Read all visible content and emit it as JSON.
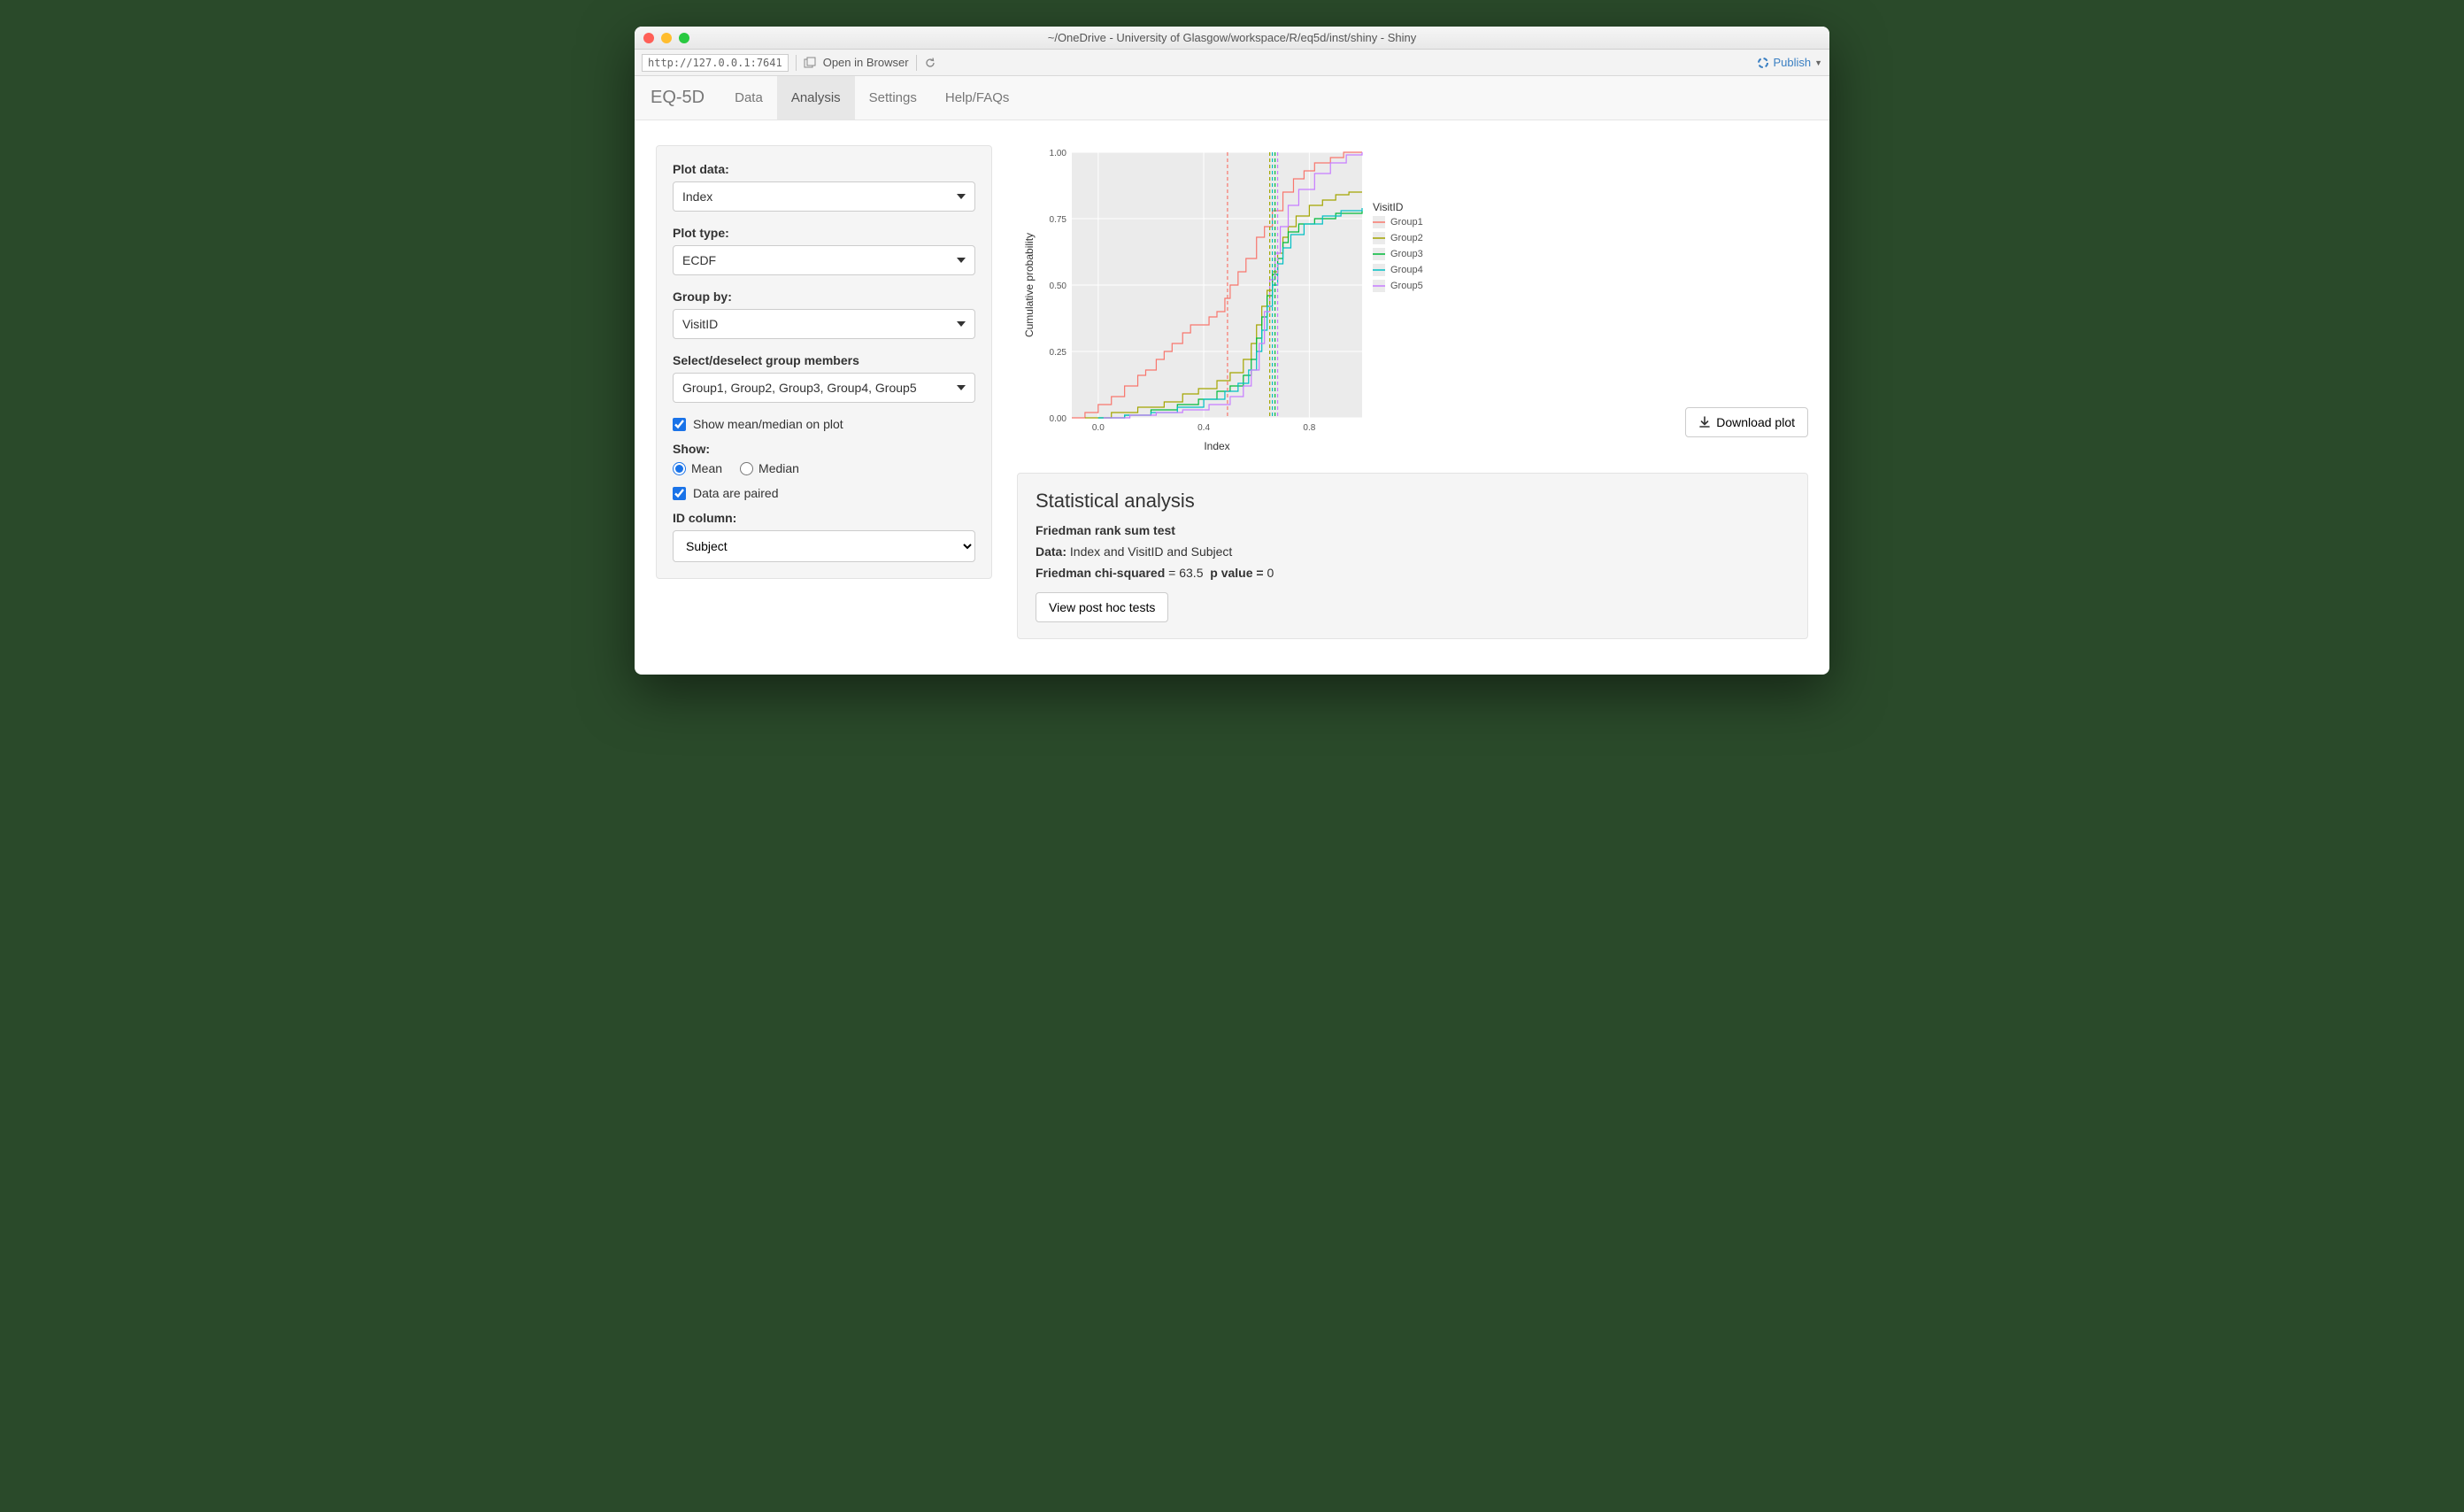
{
  "window": {
    "title": "~/OneDrive - University of Glasgow/workspace/R/eq5d/inst/shiny - Shiny"
  },
  "toolbar": {
    "url": "http://127.0.0.1:7641",
    "open_browser": "Open in Browser",
    "publish": "Publish"
  },
  "nav": {
    "brand": "EQ-5D",
    "tabs": [
      "Data",
      "Analysis",
      "Settings",
      "Help/FAQs"
    ],
    "active": "Analysis"
  },
  "sidebar": {
    "plot_data": {
      "label": "Plot data:",
      "value": "Index"
    },
    "plot_type": {
      "label": "Plot type:",
      "value": "ECDF"
    },
    "group_by": {
      "label": "Group by:",
      "value": "VisitID"
    },
    "members": {
      "label": "Select/deselect group members",
      "value": "Group1, Group2, Group3, Group4, Group5"
    },
    "show_mean_median_chk": {
      "label": "Show mean/median on plot",
      "checked": true
    },
    "show_label": "Show:",
    "radio": {
      "mean": "Mean",
      "median": "Median",
      "selected": "Mean"
    },
    "paired": {
      "label": "Data are paired",
      "checked": true
    },
    "id_col": {
      "label": "ID column:",
      "value": "Subject"
    }
  },
  "plot": {
    "download_label": "Download plot",
    "xlabel": "Index",
    "ylabel": "Cumulative probability",
    "legend_title": "VisitID",
    "legend": [
      "Group1",
      "Group2",
      "Group3",
      "Group4",
      "Group5"
    ]
  },
  "stats": {
    "heading": "Statistical analysis",
    "test_name": "Friedman rank sum test",
    "data_label": "Data:",
    "data_value": "Index and VisitID and Subject",
    "chi_label": "Friedman chi-squared",
    "chi_value": "63.5",
    "p_label": "p value =",
    "p_value": "0",
    "posthoc_btn": "View post hoc tests"
  },
  "chart_data": {
    "type": "line",
    "title": "",
    "xlabel": "Index",
    "ylabel": "Cumulative probability",
    "xlim": [
      -0.1,
      1.0
    ],
    "ylim": [
      0,
      1
    ],
    "x_ticks": [
      0.0,
      0.4,
      0.8
    ],
    "y_ticks": [
      0.0,
      0.25,
      0.5,
      0.75,
      1.0
    ],
    "legend_title": "VisitID",
    "colors": {
      "Group1": "#F8766D",
      "Group2": "#A3A500",
      "Group3": "#00BA38",
      "Group4": "#00BFC4",
      "Group5": "#C77CFF"
    },
    "means": {
      "Group1": 0.49,
      "Group2": 0.65,
      "Group3": 0.67,
      "Group4": 0.66,
      "Group5": 0.68
    },
    "series": [
      {
        "name": "Group1",
        "points": [
          [
            -0.1,
            0.0
          ],
          [
            -0.05,
            0.02
          ],
          [
            0.0,
            0.05
          ],
          [
            0.05,
            0.08
          ],
          [
            0.1,
            0.12
          ],
          [
            0.15,
            0.16
          ],
          [
            0.18,
            0.18
          ],
          [
            0.22,
            0.22
          ],
          [
            0.25,
            0.25
          ],
          [
            0.28,
            0.28
          ],
          [
            0.32,
            0.32
          ],
          [
            0.35,
            0.35
          ],
          [
            0.38,
            0.35
          ],
          [
            0.42,
            0.38
          ],
          [
            0.45,
            0.4
          ],
          [
            0.48,
            0.45
          ],
          [
            0.5,
            0.5
          ],
          [
            0.53,
            0.55
          ],
          [
            0.56,
            0.6
          ],
          [
            0.6,
            0.68
          ],
          [
            0.63,
            0.72
          ],
          [
            0.66,
            0.78
          ],
          [
            0.7,
            0.85
          ],
          [
            0.74,
            0.9
          ],
          [
            0.78,
            0.93
          ],
          [
            0.82,
            0.96
          ],
          [
            0.88,
            0.98
          ],
          [
            0.93,
            1.0
          ],
          [
            1.0,
            1.0
          ]
        ]
      },
      {
        "name": "Group2",
        "points": [
          [
            -0.05,
            0.0
          ],
          [
            0.05,
            0.02
          ],
          [
            0.15,
            0.04
          ],
          [
            0.25,
            0.06
          ],
          [
            0.32,
            0.09
          ],
          [
            0.38,
            0.11
          ],
          [
            0.45,
            0.14
          ],
          [
            0.5,
            0.17
          ],
          [
            0.55,
            0.22
          ],
          [
            0.58,
            0.28
          ],
          [
            0.6,
            0.35
          ],
          [
            0.62,
            0.42
          ],
          [
            0.64,
            0.48
          ],
          [
            0.66,
            0.55
          ],
          [
            0.68,
            0.62
          ],
          [
            0.7,
            0.68
          ],
          [
            0.72,
            0.72
          ],
          [
            0.75,
            0.76
          ],
          [
            0.8,
            0.8
          ],
          [
            0.85,
            0.82
          ],
          [
            0.9,
            0.84
          ],
          [
            0.95,
            0.85
          ],
          [
            1.0,
            0.85
          ]
        ]
      },
      {
        "name": "Group3",
        "points": [
          [
            0.0,
            0.0
          ],
          [
            0.1,
            0.01
          ],
          [
            0.2,
            0.03
          ],
          [
            0.3,
            0.05
          ],
          [
            0.38,
            0.07
          ],
          [
            0.45,
            0.1
          ],
          [
            0.5,
            0.12
          ],
          [
            0.55,
            0.16
          ],
          [
            0.58,
            0.22
          ],
          [
            0.6,
            0.3
          ],
          [
            0.62,
            0.38
          ],
          [
            0.64,
            0.46
          ],
          [
            0.66,
            0.54
          ],
          [
            0.68,
            0.6
          ],
          [
            0.7,
            0.66
          ],
          [
            0.72,
            0.7
          ],
          [
            0.76,
            0.73
          ],
          [
            0.82,
            0.75
          ],
          [
            0.9,
            0.77
          ],
          [
            1.0,
            0.78
          ]
        ]
      },
      {
        "name": "Group4",
        "points": [
          [
            0.0,
            0.0
          ],
          [
            0.1,
            0.01
          ],
          [
            0.2,
            0.02
          ],
          [
            0.3,
            0.04
          ],
          [
            0.4,
            0.07
          ],
          [
            0.48,
            0.1
          ],
          [
            0.53,
            0.13
          ],
          [
            0.57,
            0.18
          ],
          [
            0.6,
            0.25
          ],
          [
            0.62,
            0.33
          ],
          [
            0.64,
            0.42
          ],
          [
            0.66,
            0.5
          ],
          [
            0.68,
            0.58
          ],
          [
            0.7,
            0.64
          ],
          [
            0.73,
            0.69
          ],
          [
            0.78,
            0.73
          ],
          [
            0.85,
            0.76
          ],
          [
            0.92,
            0.78
          ],
          [
            1.0,
            0.79
          ]
        ]
      },
      {
        "name": "Group5",
        "points": [
          [
            0.02,
            0.0
          ],
          [
            0.12,
            0.01
          ],
          [
            0.22,
            0.02
          ],
          [
            0.32,
            0.03
          ],
          [
            0.42,
            0.05
          ],
          [
            0.5,
            0.08
          ],
          [
            0.55,
            0.12
          ],
          [
            0.58,
            0.18
          ],
          [
            0.61,
            0.28
          ],
          [
            0.63,
            0.4
          ],
          [
            0.65,
            0.52
          ],
          [
            0.67,
            0.62
          ],
          [
            0.69,
            0.72
          ],
          [
            0.72,
            0.8
          ],
          [
            0.76,
            0.86
          ],
          [
            0.82,
            0.92
          ],
          [
            0.88,
            0.96
          ],
          [
            0.94,
            0.99
          ],
          [
            1.0,
            1.0
          ]
        ]
      }
    ]
  }
}
